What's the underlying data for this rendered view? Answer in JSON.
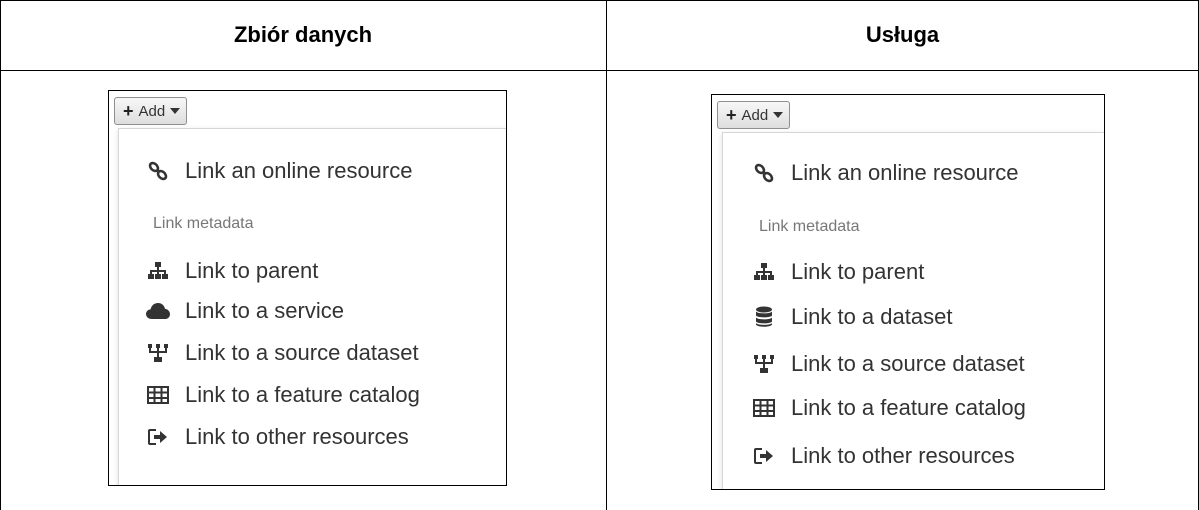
{
  "columns": [
    {
      "header": "Zbiór danych",
      "add_button": "Add",
      "online_item": "Link an online resource",
      "section_label": "Link metadata",
      "items": [
        {
          "icon": "sitemap-icon",
          "label": "Link to parent"
        },
        {
          "icon": "cloud-icon",
          "label": "Link to a service"
        },
        {
          "icon": "source-dataset-icon",
          "label": "Link to a source dataset"
        },
        {
          "icon": "table-icon",
          "label": "Link to a feature catalog"
        },
        {
          "icon": "sign-in-icon",
          "label": "Link to other resources"
        }
      ]
    },
    {
      "header": "Usługa",
      "add_button": "Add",
      "online_item": "Link an online resource",
      "section_label": "Link metadata",
      "items": [
        {
          "icon": "sitemap-icon",
          "label": "Link to parent"
        },
        {
          "icon": "database-icon",
          "label": "Link to a dataset"
        },
        {
          "icon": "source-dataset-icon",
          "label": "Link to a source dataset"
        },
        {
          "icon": "table-icon",
          "label": "Link to a feature catalog"
        },
        {
          "icon": "sign-in-icon",
          "label": "Link to other resources"
        }
      ]
    }
  ]
}
